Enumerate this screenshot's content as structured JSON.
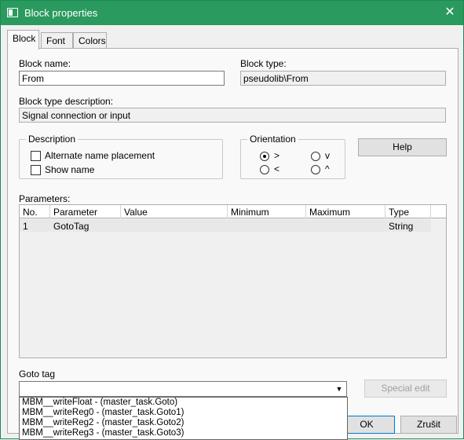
{
  "window": {
    "title": "Block properties",
    "close_glyph": "✕"
  },
  "tabs": [
    {
      "label": "Block",
      "active": true
    },
    {
      "label": "Font",
      "active": false
    },
    {
      "label": "Colors",
      "active": false
    }
  ],
  "block": {
    "name_label": "Block name:",
    "name_value": "From",
    "type_label": "Block type:",
    "type_value": "pseudolib\\From",
    "typedesc_label": "Block type description:",
    "typedesc_value": "Signal connection or input"
  },
  "description": {
    "legend": "Description",
    "alternate_name_placement": {
      "label": "Alternate name placement",
      "checked": false
    },
    "show_name": {
      "label": "Show name",
      "checked": false
    }
  },
  "orientation": {
    "legend": "Orientation",
    "options": [
      {
        "label": ">",
        "selected": true
      },
      {
        "label": "v",
        "selected": false
      },
      {
        "label": "<",
        "selected": false
      },
      {
        "label": "^",
        "selected": false
      }
    ]
  },
  "help_label": "Help",
  "parameters": {
    "label": "Parameters:",
    "columns": [
      "No.",
      "Parameter",
      "Value",
      "Minimum",
      "Maximum",
      "Type"
    ],
    "rows": [
      {
        "no": "1",
        "parameter": "GotoTag",
        "value": "",
        "minimum": "",
        "maximum": "",
        "type": "String"
      }
    ]
  },
  "goto_tag": {
    "label": "Goto tag",
    "value": "",
    "arrow_glyph": "▼",
    "options": [
      "MBM__writeFloat - (master_task.Goto)",
      "MBM__writeReg0 - (master_task.Goto1)",
      "MBM__writeReg2 - (master_task.Goto2)",
      "MBM__writeReg3 - (master_task.Goto3)"
    ]
  },
  "special_edit_label": "Special edit",
  "ok_label": "OK",
  "cancel_label": "Zrušit",
  "colors": {
    "titlebar": "#2a9a5f"
  }
}
